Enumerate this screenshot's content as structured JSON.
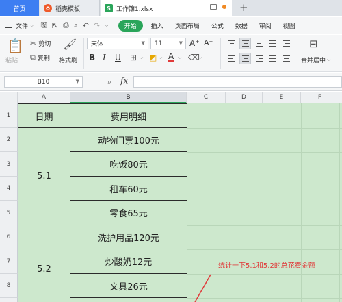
{
  "tabs": {
    "home": "首页",
    "template": "稻壳模板",
    "file": "工作簿1.xlsx",
    "new_tab": "+"
  },
  "menu": {
    "file": "文件",
    "start": "开始",
    "items": [
      "插入",
      "页面布局",
      "公式",
      "数据",
      "审阅",
      "视图"
    ]
  },
  "ribbon": {
    "paste": "粘贴",
    "cut": "剪切",
    "copy": "复制",
    "format_painter": "格式刷",
    "font_name": "宋体",
    "font_size": "11",
    "bold": "B",
    "italic": "I",
    "underline": "U",
    "grow": "A⁺",
    "shrink": "A⁻",
    "merge_center": "合并居中"
  },
  "formula_bar": {
    "name_box": "B10",
    "fx": "fx",
    "formula": ""
  },
  "sheet": {
    "columns": [
      "A",
      "B",
      "C",
      "D",
      "E",
      "F"
    ],
    "rows": [
      "1",
      "2",
      "3",
      "4",
      "5",
      "6",
      "7",
      "8"
    ],
    "header_a": "日期",
    "header_b": "费用明细",
    "date_1": "5.1",
    "date_2": "5.2",
    "items": [
      "动物门票100元",
      "吃饭80元",
      "租车60元",
      "零食65元",
      "洗护用品120元",
      "炒酸奶12元",
      "文具26元"
    ]
  },
  "annotation": "统计一下5.1和5.2的总花费金额",
  "colors": {
    "home_tab": "#3d7ef2",
    "start_button": "#2aa55a",
    "sheet_background": "#cde8cd",
    "annotation": "#e03a3a"
  }
}
